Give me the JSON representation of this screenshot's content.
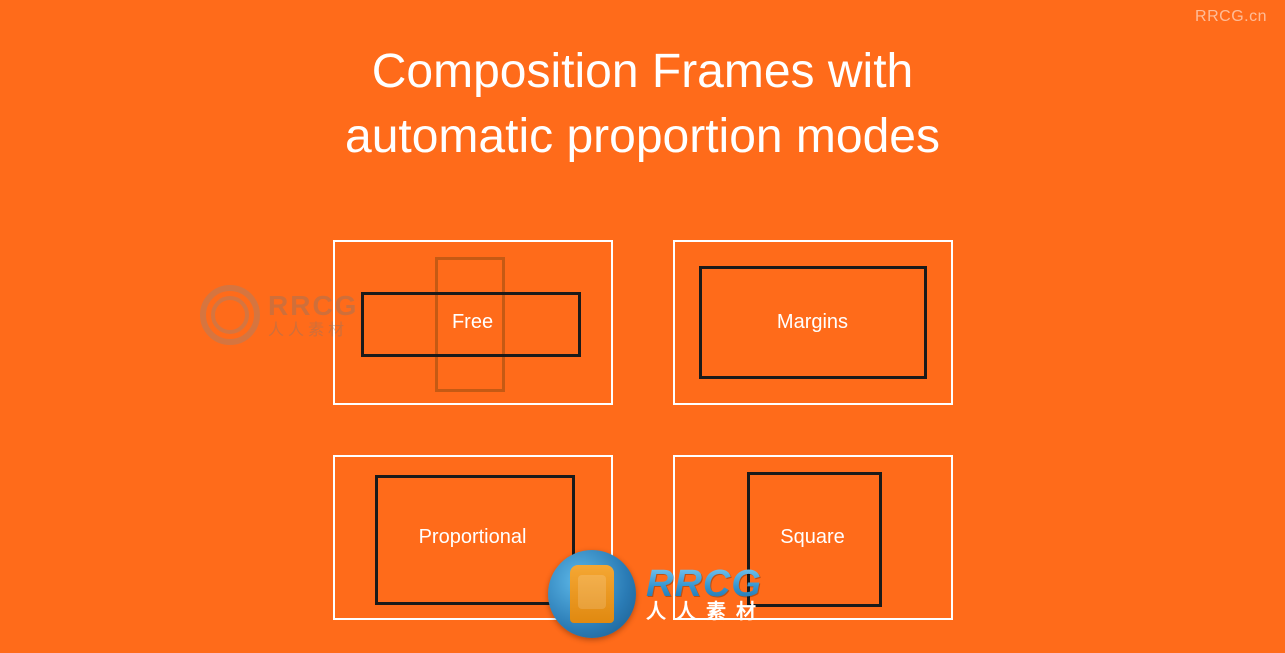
{
  "title_line1": "Composition Frames with",
  "title_line2": "automatic proportion modes",
  "modes": {
    "free": "Free",
    "margins": "Margins",
    "proportional": "Proportional",
    "square": "Square"
  },
  "watermark": {
    "top_right": "RRCG.cn",
    "brand": "RRCG",
    "brand_sub": "人人素材"
  }
}
